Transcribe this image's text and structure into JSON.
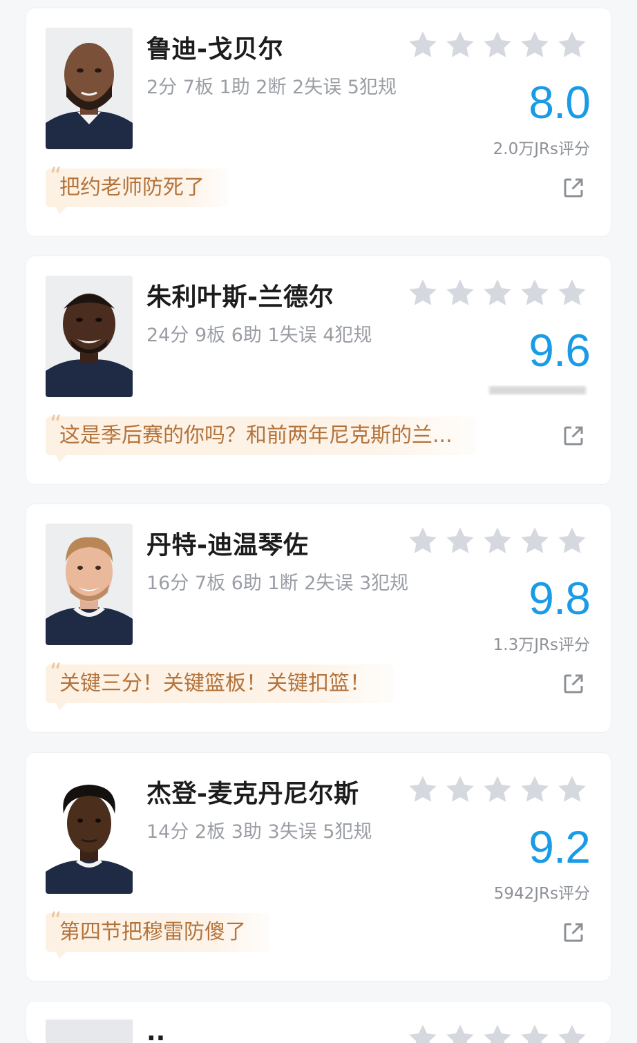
{
  "colors": {
    "score": "#1a9be6",
    "star_inactive": "#d5d8de",
    "comment_bg": "#fdf1e3",
    "comment_text": "#b4733b",
    "name_text": "#1c1c1c",
    "stat_text": "#9a9ea4"
  },
  "players": [
    {
      "name": "鲁迪-戈贝尔",
      "stats": "2分 7板 1助 2断 2失误 5犯规",
      "score": "8.0",
      "votes": "2.0万JRs评分",
      "comment": "把约老师防死了",
      "stars_filled": 0,
      "stars_total": 5,
      "share_icon": "share-external-icon"
    },
    {
      "name": "朱利叶斯-兰德尔",
      "stats": "24分 9板 6助 1失误 4犯规",
      "score": "9.6",
      "votes": "",
      "comment": "这是季后赛的你吗？和前两年尼克斯的兰...",
      "stars_filled": 0,
      "stars_total": 5,
      "share_icon": "share-external-icon"
    },
    {
      "name": "丹特-迪温琴佐",
      "stats": "16分 7板 6助 1断 2失误 3犯规",
      "score": "9.8",
      "votes": "1.3万JRs评分",
      "comment": "关键三分！关键篮板！关键扣篮！",
      "stars_filled": 0,
      "stars_total": 5,
      "share_icon": "share-external-icon"
    },
    {
      "name": "杰登-麦克丹尼尔斯",
      "stats": "14分 2板 3助 3失误 5犯规",
      "score": "9.2",
      "votes": "5942JRs评分",
      "comment": "第四节把穆雷防傻了",
      "stars_filled": 0,
      "stars_total": 5,
      "share_icon": "share-external-icon"
    }
  ],
  "partial_card": {
    "name": ".."
  }
}
